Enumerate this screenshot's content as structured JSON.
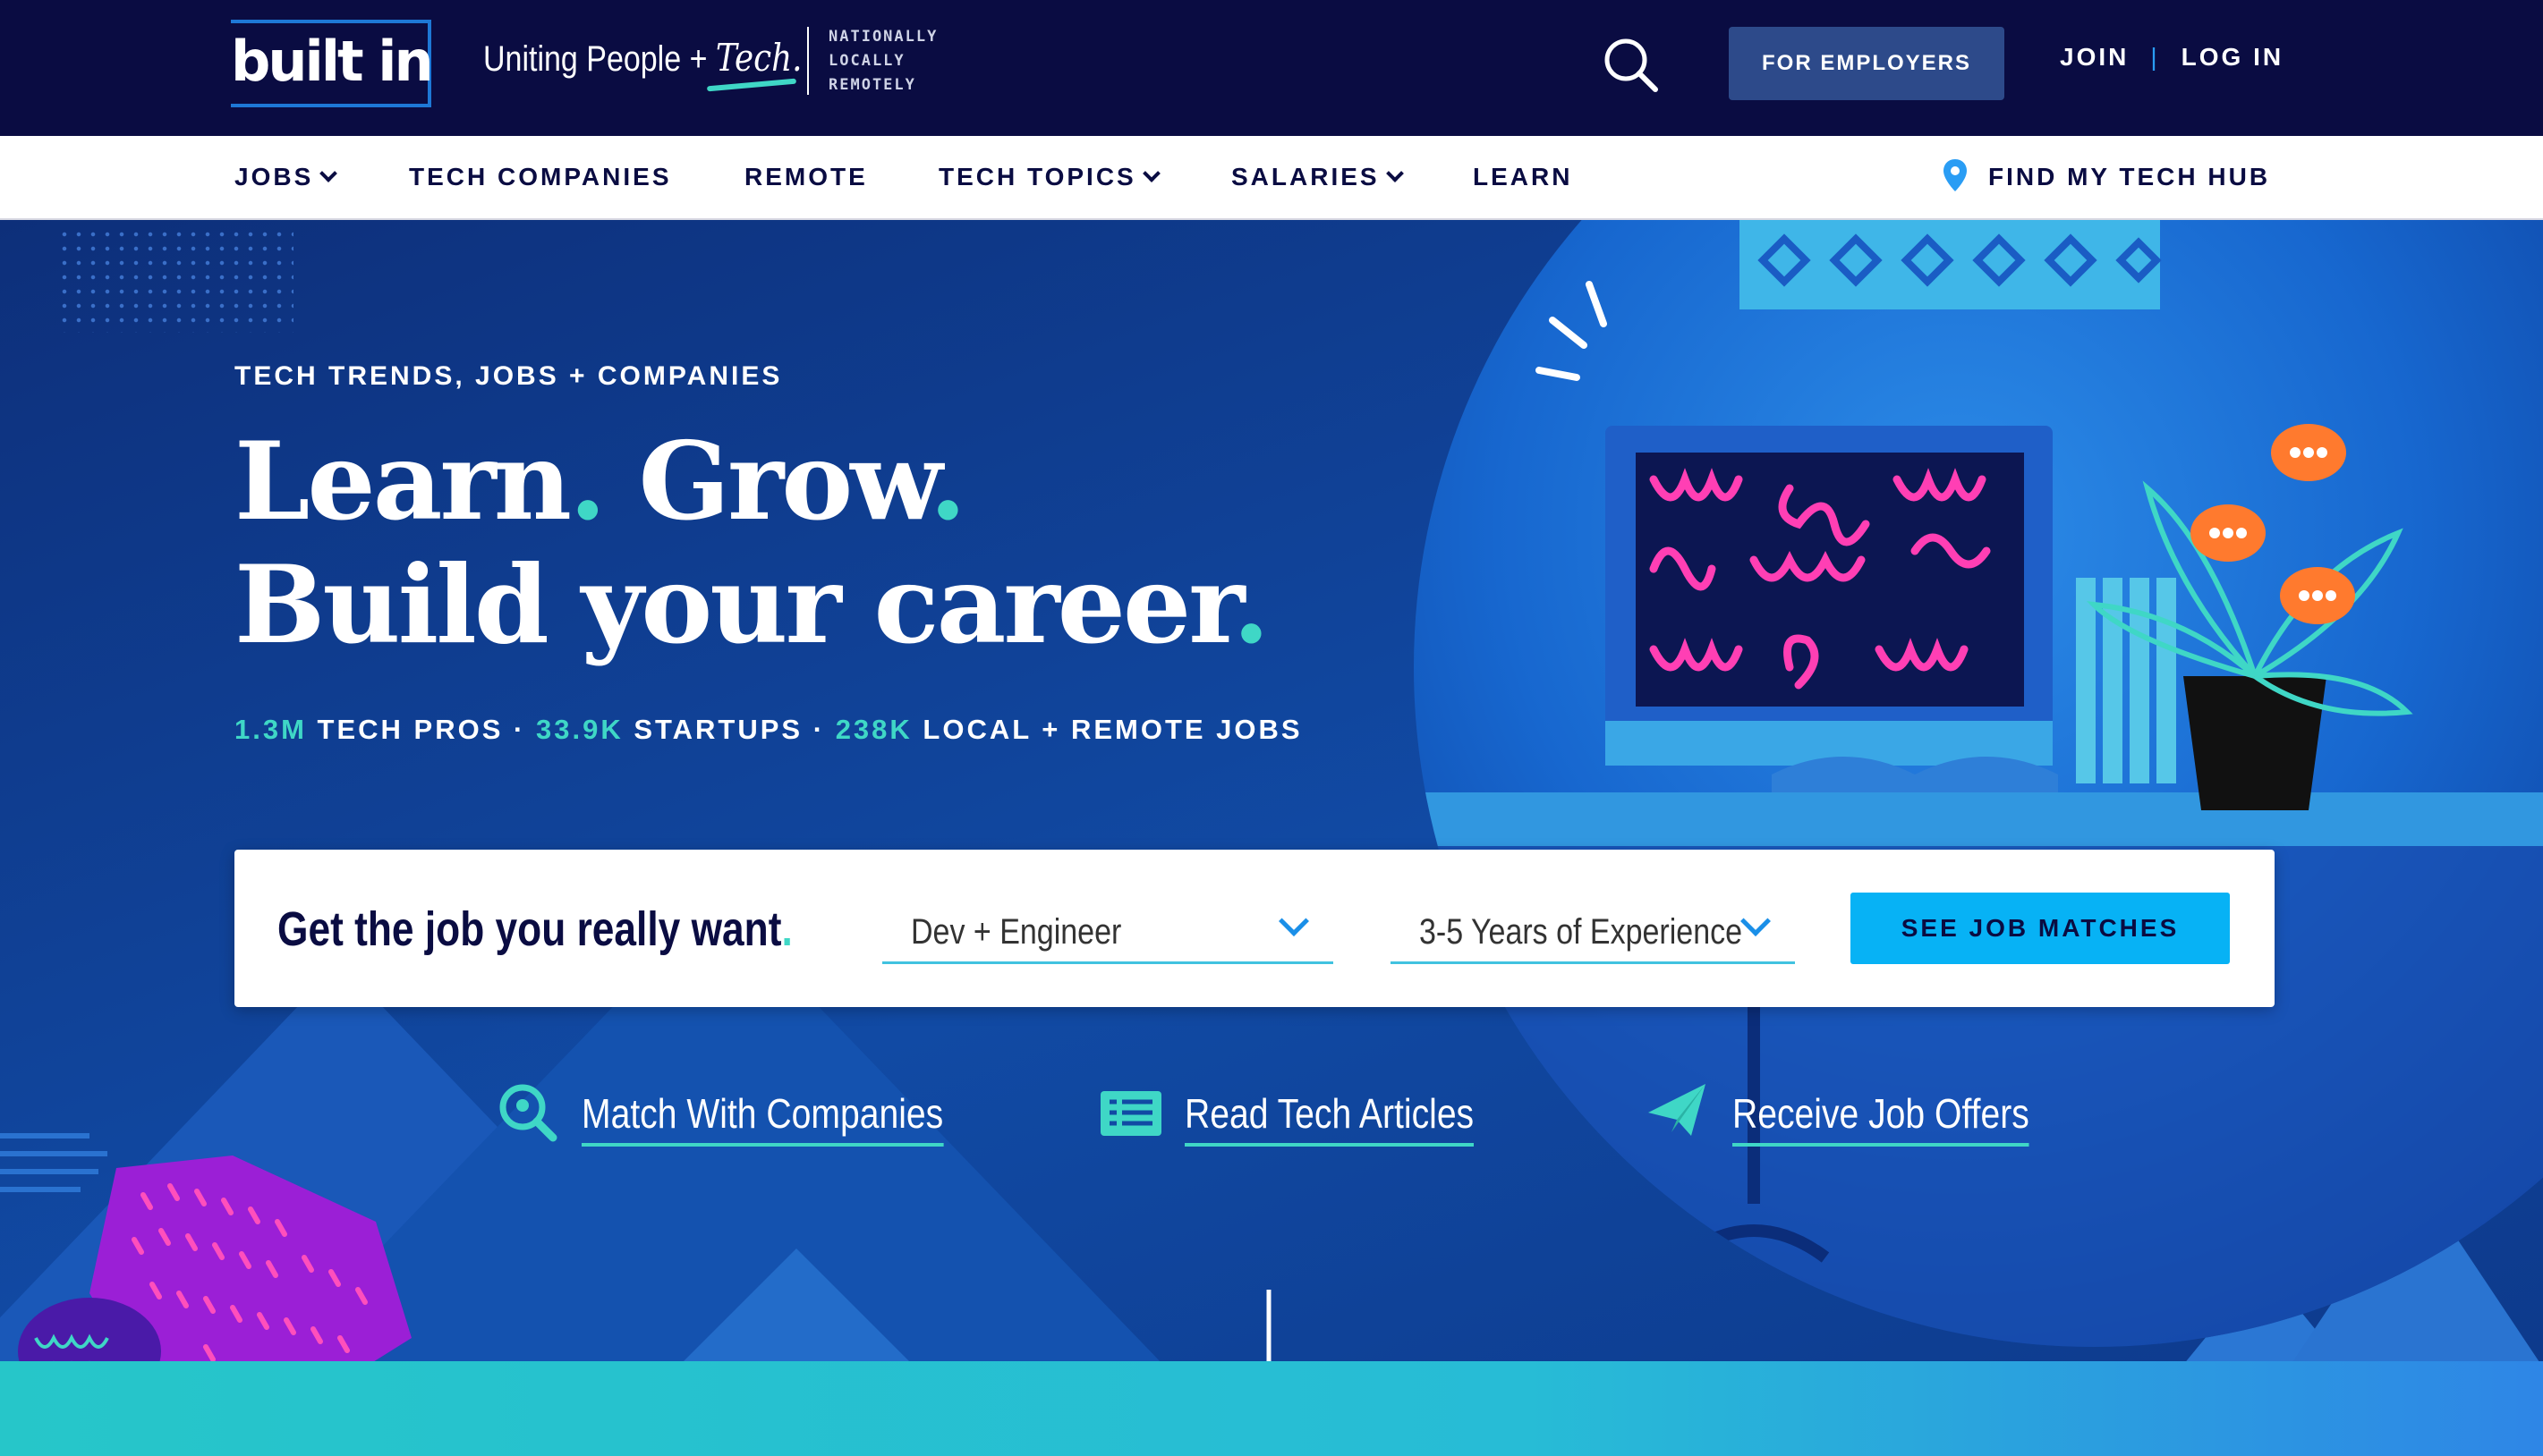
{
  "header": {
    "logo": "built in",
    "tagline_prefix": "Uniting People +",
    "tagline_tech": "Tech.",
    "reach": [
      "NATIONALLY",
      "LOCALLY",
      "REMOTELY"
    ],
    "for_employers": "FOR EMPLOYERS",
    "join": "JOIN",
    "separator": "|",
    "login": "LOG IN"
  },
  "nav": {
    "items": [
      {
        "label": "JOBS"
      },
      {
        "label": "TECH COMPANIES"
      },
      {
        "label": "REMOTE"
      },
      {
        "label": "TECH TOPICS"
      },
      {
        "label": "SALARIES"
      },
      {
        "label": "LEARN"
      }
    ],
    "find_hub": "FIND MY TECH HUB"
  },
  "hero": {
    "eyebrow": "TECH TRENDS, JOBS + COMPANIES",
    "line1_a": "Learn",
    "line1_b": "Grow",
    "line2": "Build your career",
    "dot": ".",
    "stats": {
      "pros_num": "1.3M",
      "pros_label": "TECH PROS",
      "startups_num": "33.9K",
      "startups_label": "STARTUPS",
      "jobs_num": "238K",
      "jobs_label": "LOCAL + REMOTE JOBS",
      "bullet": "·"
    }
  },
  "job_card": {
    "title": "Get the job you really want",
    "category_value": "Dev + Engineer",
    "experience_value": "3-5 Years of Experience",
    "cta": "SEE JOB MATCHES"
  },
  "features": [
    {
      "label": "Match With Companies",
      "icon": "search-pin-icon"
    },
    {
      "label": "Read Tech Articles",
      "icon": "newspaper-icon"
    },
    {
      "label": "Receive Job Offers",
      "icon": "paper-plane-icon"
    }
  ],
  "colors": {
    "navy": "#0a0c42",
    "accent_teal": "#3fd7c6",
    "cta_blue": "#07b2f5",
    "employer_btn": "#2d4a8a"
  }
}
